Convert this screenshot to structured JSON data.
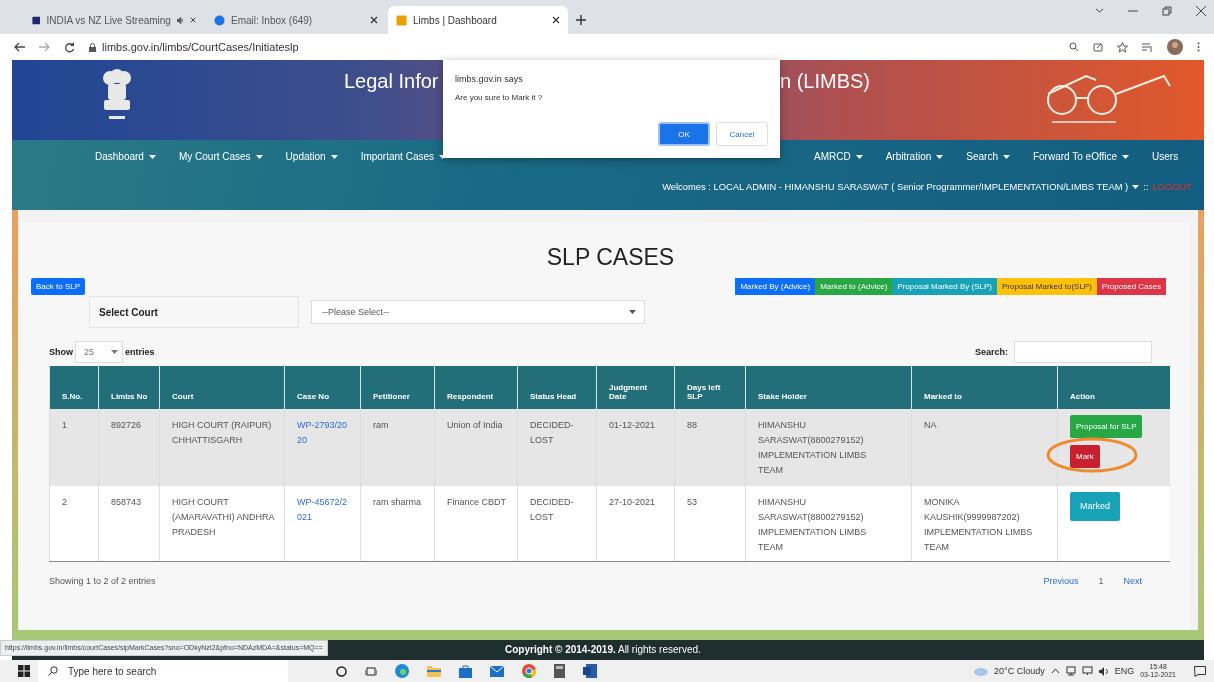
{
  "browser": {
    "tabs": [
      {
        "title": "INDIA vs NZ Live Streaming",
        "selected": false,
        "audio": true
      },
      {
        "title": "Email: Inbox (649)",
        "selected": false,
        "audio": false
      },
      {
        "title": "Limbs | Dashboard",
        "selected": true,
        "audio": false
      }
    ],
    "url": "limbs.gov.in/limbs/CourtCases/Initiateslp"
  },
  "header": {
    "title_start": "Legal Infor",
    "title_end": "n (LIMBS)"
  },
  "nav": {
    "items_start": [
      {
        "label": "Dashboard",
        "dropdown": true
      },
      {
        "label": "My Court Cases",
        "dropdown": true
      },
      {
        "label": "Updation",
        "dropdown": true
      },
      {
        "label": "Important Cases",
        "dropdown": true
      }
    ],
    "items_end": [
      {
        "label": "AMRCD",
        "dropdown": true
      },
      {
        "label": "Arbitration",
        "dropdown": true
      },
      {
        "label": "Search",
        "dropdown": true
      },
      {
        "label": "Forward To eOffice",
        "dropdown": true
      },
      {
        "label": "Users",
        "dropdown": false
      }
    ],
    "welcome": "Welcomes : LOCAL ADMIN - HIMANSHU SARASWAT ( Senior Programmer/IMPLEMENTATION/LIMBS TEAM )",
    "separator": "::",
    "logout": "LOGOUT"
  },
  "dialog": {
    "title": "limbs.gov.in says",
    "message": "Are you sure to Mark it ?",
    "ok": "OK",
    "cancel": "Cancel"
  },
  "page": {
    "title": "SLP CASES",
    "back_button": "Back to SLP",
    "legend": [
      {
        "label": "Marked By (Advice)",
        "color": "#0d6efd"
      },
      {
        "label": "Marked to (Advice)",
        "color": "#28a745"
      },
      {
        "label": "Proposal Marked By (SLP)",
        "color": "#17a2b8"
      },
      {
        "label": "Proposal Marked to(SLP)",
        "color": "#ffc107"
      },
      {
        "label": "Proposed Cases",
        "color": "#dc3545"
      }
    ],
    "select_label": "Select Court",
    "select_value": "--Please Select--",
    "show_label": "Show",
    "page_size": "25",
    "entries_label": "entries",
    "search_label": "Search:",
    "columns": [
      "S.No.",
      "Limbs No",
      "Court",
      "Case No",
      "Petitioner",
      "Respondent",
      "Status Head",
      "Judgment Date",
      "Days left SLP",
      "Stake Holder",
      "Marked to",
      "Action"
    ],
    "rows": [
      {
        "selected": true,
        "sno": "1",
        "limbs_no": "892726",
        "court": "HIGH COURT (RAIPUR) CHHATTISGARH",
        "case_no": "WP-2793/2020",
        "petitioner": "ram",
        "respondent": "Union of India",
        "status": "DECIDED-LOST",
        "judgment_date": "01-12-2021",
        "days_left": "88",
        "stake_holder": "HIMANSHU SARASWAT(8800279152) IMPLEMENTATION LIMBS TEAM",
        "marked_to": "NA",
        "actions": [
          {
            "label": "Proposal for SLP",
            "kind": "proposal",
            "circled": false
          },
          {
            "label": "Mark",
            "kind": "mark",
            "circled": true
          }
        ]
      },
      {
        "selected": false,
        "sno": "2",
        "limbs_no": "858743",
        "court": "HIGH COURT (AMARAVATHI) ANDHRA PRADESH",
        "case_no": "WP-45672/2021",
        "petitioner": "ram sharma",
        "respondent": "Finance CBDT",
        "status": "DECIDED-LOST",
        "judgment_date": "27-10-2021",
        "days_left": "53",
        "stake_holder": "HIMANSHU SARASWAT(8800279152) IMPLEMENTATION LIMBS TEAM",
        "marked_to": "MONIKA KAUSHIK(9999987202) IMPLEMENTATION LIMBS TEAM",
        "actions": [
          {
            "label": "Marked",
            "kind": "marked",
            "circled": false
          }
        ]
      }
    ],
    "info": "Showing 1 to 2 of 2 entries",
    "pagination": [
      {
        "label": "Previous",
        "kind": "prev"
      },
      {
        "label": "1",
        "kind": "page"
      },
      {
        "label": "Next",
        "kind": "next"
      }
    ]
  },
  "footer": {
    "status_url": "https://limbs.gov.in/limbs/courtCases/slpMarkCases?sno=ODkyNzI2&pfno=NDAzMDA=&status=MQ==",
    "copyright": "**Copyright © 2014-2019.** All rights reserved."
  },
  "taskbar": {
    "search_placeholder": "Type here to search",
    "weather": "20°C Cloudy",
    "language": "ENG",
    "time": "15:48",
    "date": "03-12-2021"
  }
}
